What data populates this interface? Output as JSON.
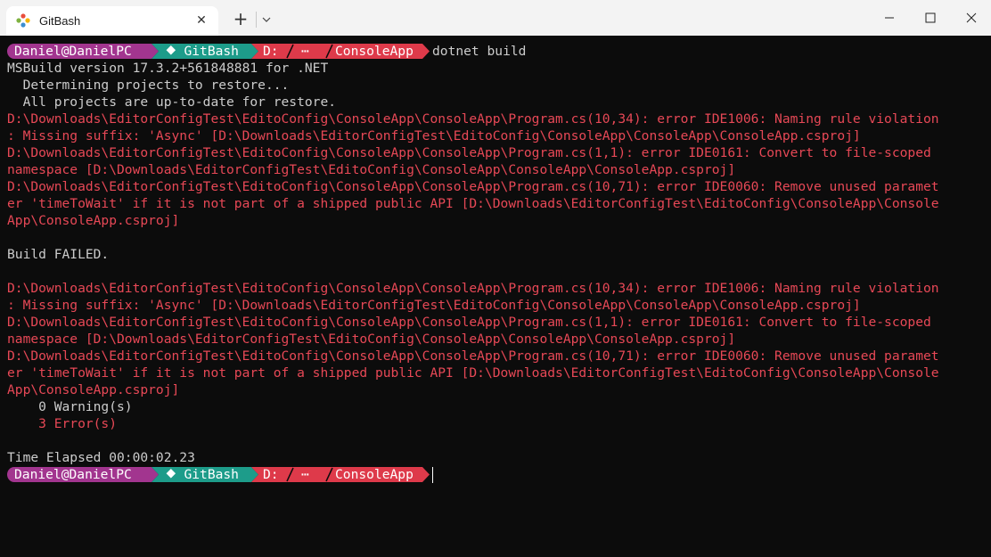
{
  "window": {
    "tab_title": "GitBash",
    "close_tab_label": "✕",
    "new_tab_label": "+"
  },
  "prompt": {
    "user": "Daniel@DanielPC",
    "shell": "⯁ GitBash",
    "drive": "D:",
    "ellipsis": "⋯",
    "folder": "ConsoleApp",
    "colors": {
      "user": "#a2358f",
      "shell": "#1d9c8a",
      "path": "#de3a4a"
    }
  },
  "command": "dotnet build",
  "output": [
    {
      "text": "MSBuild version 17.3.2+561848881 for .NET",
      "style": "normal"
    },
    {
      "text": "  Determining projects to restore...",
      "style": "normal"
    },
    {
      "text": "  All projects are up-to-date for restore.",
      "style": "normal"
    },
    {
      "text": "D:\\Downloads\\EditorConfigTest\\EditoConfig\\ConsoleApp\\ConsoleApp\\Program.cs(10,34): error IDE1006: Naming rule violation",
      "style": "error"
    },
    {
      "text": ": Missing suffix: 'Async' [D:\\Downloads\\EditorConfigTest\\EditoConfig\\ConsoleApp\\ConsoleApp\\ConsoleApp.csproj]",
      "style": "error"
    },
    {
      "text": "D:\\Downloads\\EditorConfigTest\\EditoConfig\\ConsoleApp\\ConsoleApp\\Program.cs(1,1): error IDE0161: Convert to file-scoped",
      "style": "error"
    },
    {
      "text": "namespace [D:\\Downloads\\EditorConfigTest\\EditoConfig\\ConsoleApp\\ConsoleApp\\ConsoleApp.csproj]",
      "style": "error"
    },
    {
      "text": "D:\\Downloads\\EditorConfigTest\\EditoConfig\\ConsoleApp\\ConsoleApp\\Program.cs(10,71): error IDE0060: Remove unused paramet",
      "style": "error"
    },
    {
      "text": "er 'timeToWait' if it is not part of a shipped public API [D:\\Downloads\\EditorConfigTest\\EditoConfig\\ConsoleApp\\Console",
      "style": "error"
    },
    {
      "text": "App\\ConsoleApp.csproj]",
      "style": "error"
    },
    {
      "text": "",
      "style": "normal"
    },
    {
      "text": "Build FAILED.",
      "style": "normal"
    },
    {
      "text": "",
      "style": "normal"
    },
    {
      "text": "D:\\Downloads\\EditorConfigTest\\EditoConfig\\ConsoleApp\\ConsoleApp\\Program.cs(10,34): error IDE1006: Naming rule violation",
      "style": "error"
    },
    {
      "text": ": Missing suffix: 'Async' [D:\\Downloads\\EditorConfigTest\\EditoConfig\\ConsoleApp\\ConsoleApp\\ConsoleApp.csproj]",
      "style": "error"
    },
    {
      "text": "D:\\Downloads\\EditorConfigTest\\EditoConfig\\ConsoleApp\\ConsoleApp\\Program.cs(1,1): error IDE0161: Convert to file-scoped",
      "style": "error"
    },
    {
      "text": "namespace [D:\\Downloads\\EditorConfigTest\\EditoConfig\\ConsoleApp\\ConsoleApp\\ConsoleApp.csproj]",
      "style": "error"
    },
    {
      "text": "D:\\Downloads\\EditorConfigTest\\EditoConfig\\ConsoleApp\\ConsoleApp\\Program.cs(10,71): error IDE0060: Remove unused paramet",
      "style": "error"
    },
    {
      "text": "er 'timeToWait' if it is not part of a shipped public API [D:\\Downloads\\EditorConfigTest\\EditoConfig\\ConsoleApp\\Console",
      "style": "error"
    },
    {
      "text": "App\\ConsoleApp.csproj]",
      "style": "error"
    },
    {
      "text": "    0 Warning(s)",
      "style": "normal"
    },
    {
      "text": "    3 Error(s)",
      "style": "error"
    },
    {
      "text": "",
      "style": "normal"
    },
    {
      "text": "Time Elapsed 00:00:02.23",
      "style": "normal"
    }
  ]
}
